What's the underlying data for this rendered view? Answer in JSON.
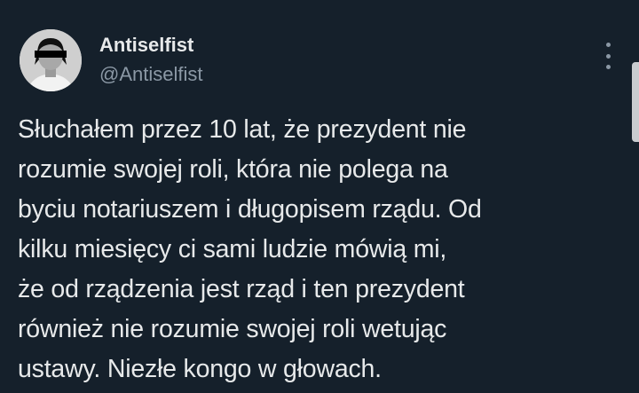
{
  "author": {
    "display_name": "Antiselfist",
    "handle": "@Antiselfist",
    "avatar_icon": "profile-photo-censored"
  },
  "more_menu": {
    "icon": "more-vertical-icon"
  },
  "tweet": {
    "lines": [
      "Słuchałem przez 10 lat, że prezydent nie",
      "rozumie swojej roli, która nie polega na",
      "byciu notariuszem i długopisem rządu. Od",
      "kilku miesięcy ci sami ludzie mówią mi,",
      "że od rządzenia jest rząd i ten prezydent",
      "również nie rozumie swojej roli wetując",
      "ustawy. Niezłe kongo w głowach."
    ]
  },
  "colors": {
    "background": "#15202b",
    "primary_text": "#e7e9ea",
    "secondary_text": "#8b98a5"
  }
}
